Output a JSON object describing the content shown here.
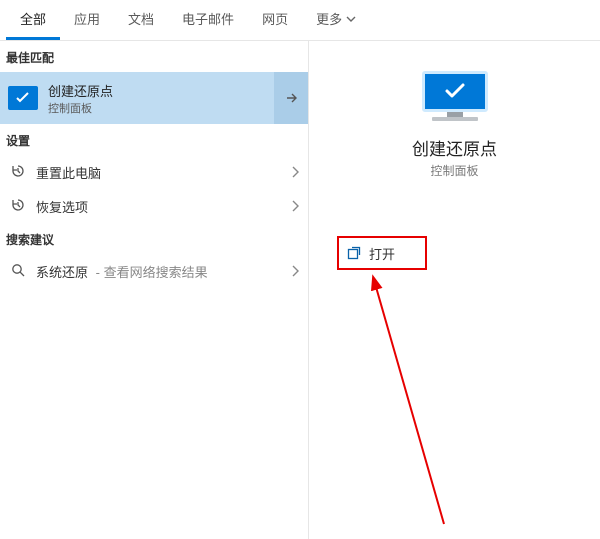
{
  "tabs": {
    "all": "全部",
    "apps": "应用",
    "docs": "文档",
    "email": "电子邮件",
    "web": "网页",
    "more": "更多"
  },
  "groups": {
    "best_header": "最佳匹配",
    "settings_header": "设置",
    "suggest_header": "搜索建议"
  },
  "best": {
    "title": "创建还原点",
    "sub": "控制面板",
    "icon": "monitor-check-icon"
  },
  "settings_rows": [
    {
      "icon": "history-icon",
      "label": "重置此电脑"
    },
    {
      "icon": "history-icon",
      "label": "恢复选项"
    }
  ],
  "suggest_rows": [
    {
      "icon": "search-icon",
      "label": "系统还原",
      "hint": " - 查看网络搜索结果"
    }
  ],
  "detail": {
    "title": "创建还原点",
    "sub": "控制面板",
    "open_label": "打开"
  }
}
